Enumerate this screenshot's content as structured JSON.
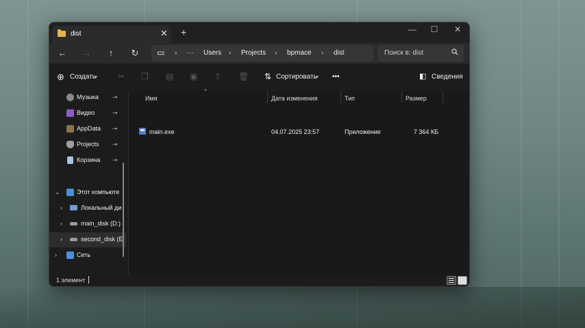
{
  "window": {
    "tab_title": "dist",
    "close_glyph": "✕",
    "new_tab_glyph": "+",
    "minimize_glyph": "—",
    "maximize_glyph": "☐",
    "window_close_glyph": "✕"
  },
  "nav": {
    "back_glyph": "←",
    "forward_glyph": "→",
    "up_glyph": "↑",
    "refresh_glyph": "↻"
  },
  "address": {
    "monitor_glyph": "▭",
    "sep": "›",
    "ellipsis": "···",
    "crumbs": [
      "Users",
      "Projects",
      "bpmace",
      "dist"
    ]
  },
  "search": {
    "placeholder": "Поиск в: dist",
    "icon": "search-icon"
  },
  "toolbar": {
    "create_label": "Создать",
    "sort_label": "Сортировать",
    "more_glyph": "•••",
    "details_label": "Сведения"
  },
  "sidebar": {
    "pin_glyph": "📌",
    "items": [
      {
        "label": "Музыка",
        "icon": "music-icon",
        "color": "#c07040"
      },
      {
        "label": "Видео",
        "icon": "video-icon",
        "color": "#8a5cc8"
      },
      {
        "label": "AppData",
        "icon": "folder-icon",
        "color": "#c9a452"
      },
      {
        "label": "Projects",
        "icon": "projects-icon",
        "color": "#9aa0a6"
      },
      {
        "label": "Корзина",
        "icon": "recycle-bin-icon",
        "color": "#a7c4e0"
      },
      {
        "label": "Этот компьюте",
        "icon": "computer-icon",
        "color": "#4a90d9"
      },
      {
        "label": "Локальный ди",
        "icon": "drive-icon",
        "color": "#6aa0d8"
      },
      {
        "label": "main_disk (D:)",
        "icon": "drive-icon",
        "color": "#9a9a9a"
      },
      {
        "label": "second_disk (E",
        "icon": "drive-icon",
        "color": "#9a9a9a"
      },
      {
        "label": "Сеть",
        "icon": "network-icon",
        "color": "#4a90d9"
      }
    ]
  },
  "columns": {
    "name": "Имя",
    "date": "Дата изменения",
    "type": "Тип",
    "size": "Размер"
  },
  "files": [
    {
      "name": "main.exe",
      "date": "04.07.2025 23:57",
      "type": "Приложение",
      "size": "7 364 КБ"
    }
  ],
  "status": {
    "count": "1 элемент"
  }
}
